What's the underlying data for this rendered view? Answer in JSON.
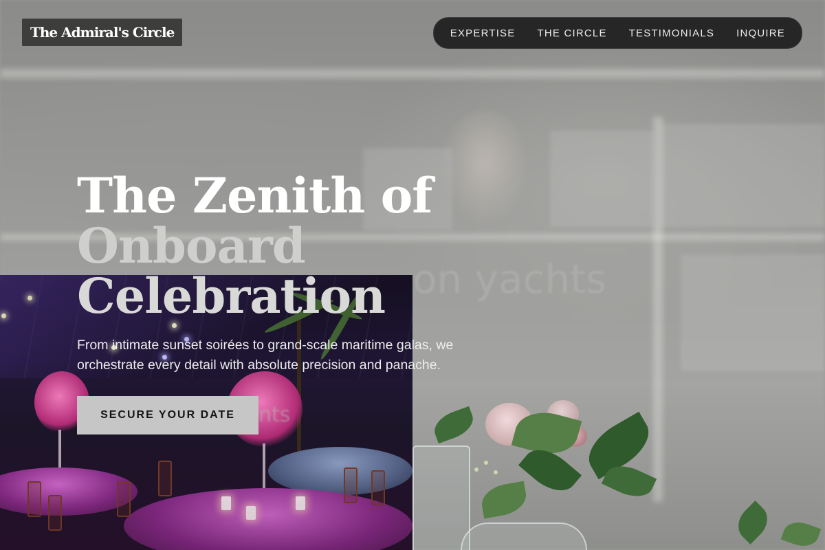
{
  "brand": {
    "logo_text": "The Admiral's Circle"
  },
  "nav": {
    "items": [
      {
        "label": "EXPERTISE"
      },
      {
        "label": "THE CIRCLE"
      },
      {
        "label": "TESTIMONIALS"
      },
      {
        "label": "INQUIRE"
      }
    ]
  },
  "hero": {
    "title_line1": "The Zenith of",
    "title_line2": "Onboard",
    "title_line3": "Celebration",
    "subtitle": "From intimate sunset soirées to grand-scale maritime galas, we orchestrate every detail with absolute precision and panache.",
    "cta_label": "SECURE YOUR DATE"
  },
  "background": {
    "ghost_text_large": "on yachts",
    "ghost_text_small": "nts"
  },
  "colors": {
    "nav_bg": "#262626",
    "logo_bg": "#3d3d3c",
    "cta_bg": "#c6c6c6",
    "title_primary": "#ffffff",
    "title_muted": "#cfcfcd"
  }
}
